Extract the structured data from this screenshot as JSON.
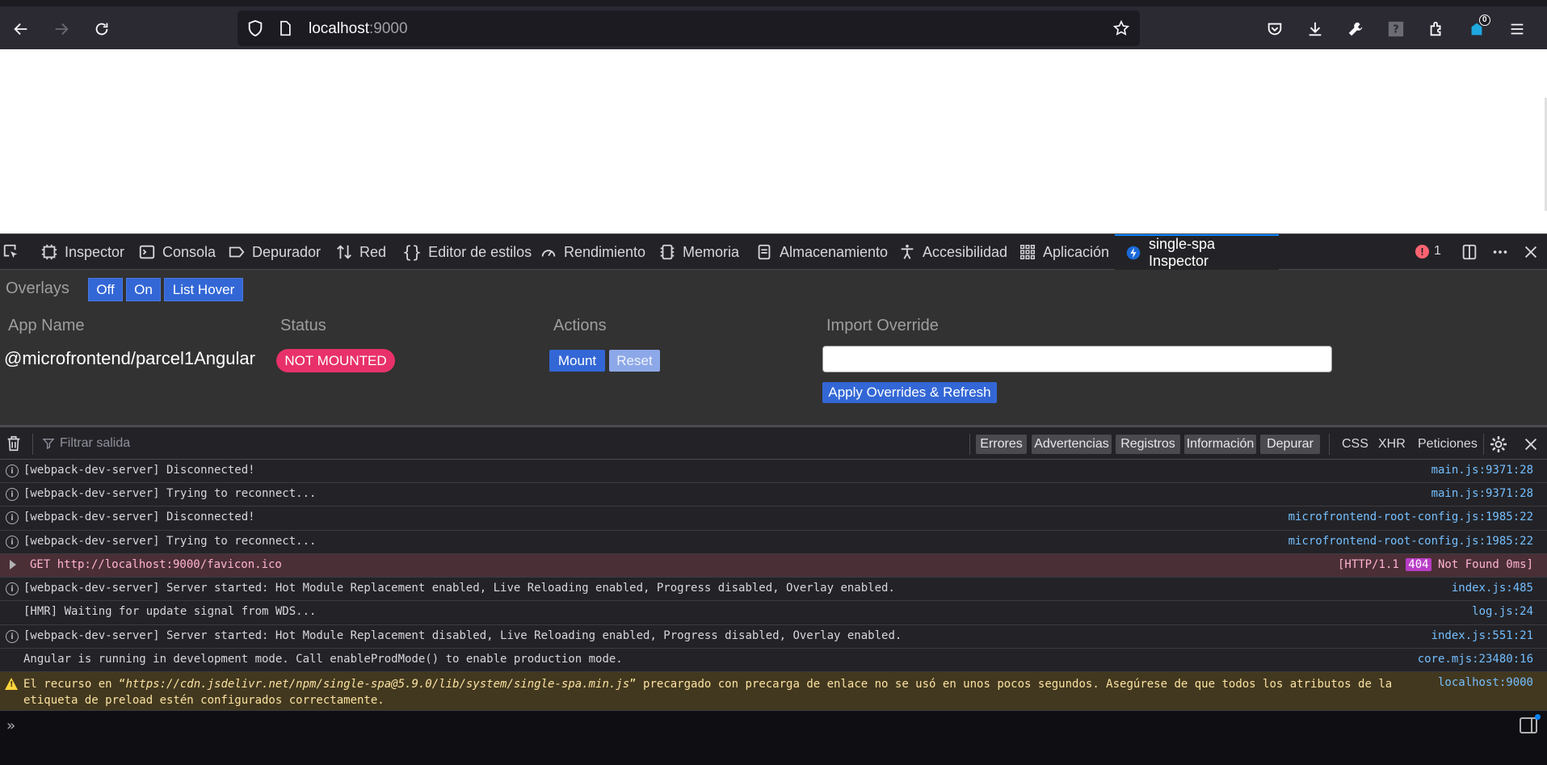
{
  "browser": {
    "url_host": "localhost",
    "url_port": ":9000",
    "extension_badge": "0"
  },
  "devtools": {
    "tabs": [
      "Inspector",
      "Consola",
      "Depurador",
      "Red",
      "Editor de estilos",
      "Rendimiento",
      "Memoria",
      "Almacenamiento",
      "Accesibilidad",
      "Aplicación",
      "single-spa Inspector"
    ],
    "error_count": "1"
  },
  "spa_inspector": {
    "overlays_label": "Overlays",
    "overlay_buttons": [
      "Off",
      "On",
      "List Hover"
    ],
    "columns": [
      "App Name",
      "Status",
      "Actions",
      "Import Override"
    ],
    "app": {
      "name": "@microfrontend/parcel1Angular",
      "status": "NOT MOUNTED",
      "actions": [
        "Mount",
        "Reset"
      ]
    },
    "apply_button": "Apply Overrides & Refresh"
  },
  "console": {
    "filter_placeholder": "Filtrar salida",
    "levels": [
      "Errores",
      "Advertencias",
      "Registros",
      "Información",
      "Depurar"
    ],
    "extra_filters": [
      "CSS",
      "XHR",
      "Peticiones"
    ],
    "logs": [
      {
        "msg": "[webpack-dev-server] Disconnected!",
        "src": "main.js:9371:28"
      },
      {
        "msg": "[webpack-dev-server] Trying to reconnect...",
        "src": "main.js:9371:28"
      },
      {
        "msg": "[webpack-dev-server] Disconnected!",
        "src": "microfrontend-root-config.js:1985:22"
      },
      {
        "msg": "[webpack-dev-server] Trying to reconnect...",
        "src": "microfrontend-root-config.js:1985:22"
      },
      {
        "msg": "GET http://localhost:9000/favicon.ico",
        "src_pre": "[HTTP/1.1 ",
        "src_code": "404",
        "src_post": " Not Found 0ms]"
      },
      {
        "msg": "[webpack-dev-server] Server started: Hot Module Replacement enabled, Live Reloading enabled, Progress disabled, Overlay enabled.",
        "src": "index.js:485"
      },
      {
        "msg": "[HMR] Waiting for update signal from WDS...",
        "src": "log.js:24"
      },
      {
        "msg": "[webpack-dev-server] Server started: Hot Module Replacement disabled, Live Reloading enabled, Progress disabled, Overlay enabled.",
        "src": "index.js:551:21"
      },
      {
        "msg": "Angular is running in development mode. Call enableProdMode() to enable production mode.",
        "src": "core.mjs:23480:16"
      }
    ],
    "warning": {
      "pre": "El recurso en “",
      "url": "https://cdn.jsdelivr.net/npm/single-spa@5.9.0/lib/system/single-spa.min.js",
      "post": "” precargado con precarga de enlace no se usó en unos pocos segundos. Asegúrese de que todos los atributos de la etiqueta de preload estén configurados correctamente.",
      "src": "localhost:9000"
    }
  }
}
